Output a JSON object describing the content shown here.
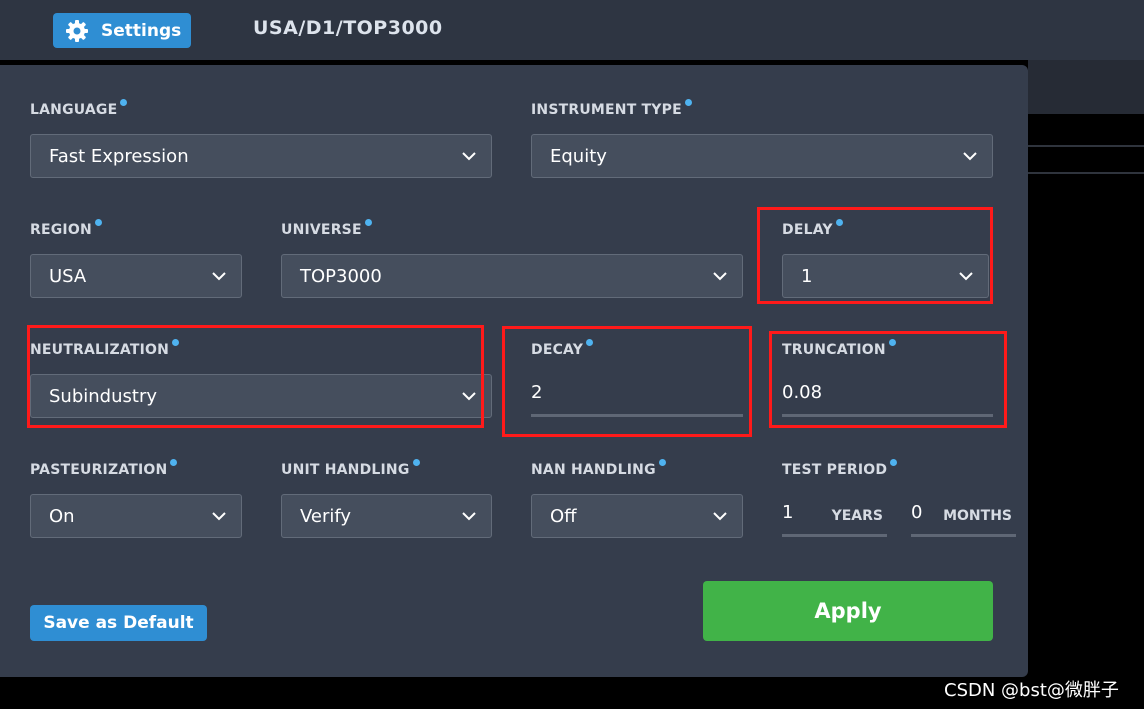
{
  "header": {
    "settings_label": "Settings",
    "breadcrumb": "USA/D1/TOP3000"
  },
  "form": {
    "language": {
      "label": "LANGUAGE",
      "value": "Fast Expression"
    },
    "instrument_type": {
      "label": "INSTRUMENT TYPE",
      "value": "Equity"
    },
    "region": {
      "label": "REGION",
      "value": "USA"
    },
    "universe": {
      "label": "UNIVERSE",
      "value": "TOP3000"
    },
    "delay": {
      "label": "DELAY",
      "value": "1"
    },
    "neutralization": {
      "label": "NEUTRALIZATION",
      "value": "Subindustry"
    },
    "decay": {
      "label": "DECAY",
      "value": "2"
    },
    "truncation": {
      "label": "TRUNCATION",
      "value": "0.08"
    },
    "pasteurization": {
      "label": "PASTEURIZATION",
      "value": "On"
    },
    "unit_handling": {
      "label": "UNIT HANDLING",
      "value": "Verify"
    },
    "nan_handling": {
      "label": "NAN HANDLING",
      "value": "Off"
    },
    "test_period": {
      "label": "TEST PERIOD",
      "years_value": "1",
      "years_unit": "YEARS",
      "months_value": "0",
      "months_unit": "MONTHS"
    }
  },
  "actions": {
    "save_default": "Save as Default",
    "apply": "Apply"
  },
  "watermark": "CSDN @bst@微胖子",
  "colors": {
    "accent": "#2f8ed3",
    "apply": "#41b348",
    "highlight": "#ff1a1a",
    "info_dot": "#4fb3f0"
  },
  "icons": {
    "settings": "gear-icon",
    "dropdown": "chevron-down-icon",
    "info": "info-dot-icon"
  }
}
